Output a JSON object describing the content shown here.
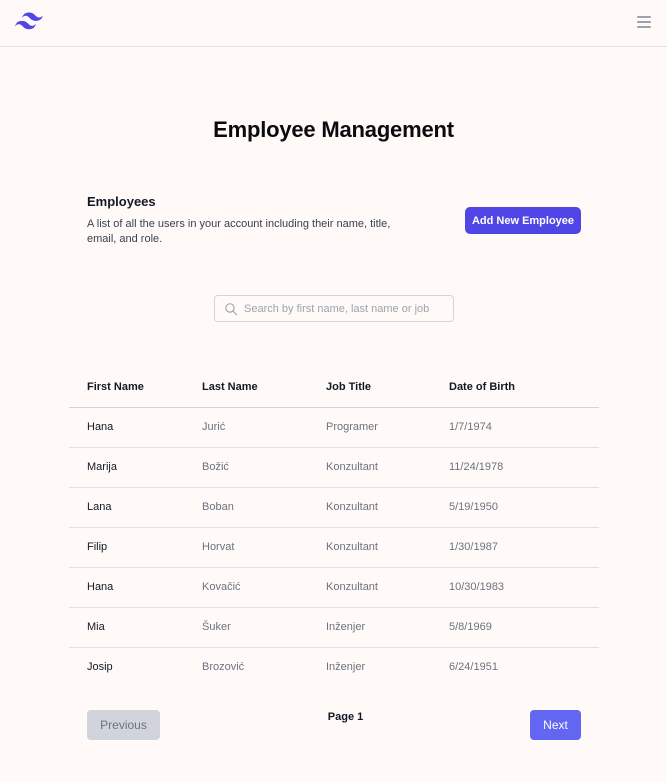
{
  "header": {
    "logo_icon": "tailwind-logo-icon",
    "menu_icon": "hamburger-menu-icon"
  },
  "page": {
    "title": "Employee Management"
  },
  "section": {
    "title": "Employees",
    "description": "A list of all the users in your account including their name, title, email, and role."
  },
  "actions": {
    "add_label": "Add New Employee"
  },
  "search": {
    "placeholder": "Search by first name, last name or job",
    "value": ""
  },
  "table": {
    "columns": [
      "First Name",
      "Last Name",
      "Job Title",
      "Date of Birth"
    ],
    "rows": [
      [
        "Hana",
        "Jurić",
        "Programer",
        "1/7/1974"
      ],
      [
        "Marija",
        "Božić",
        "Konzultant",
        "11/24/1978"
      ],
      [
        "Lana",
        "Boban",
        "Konzultant",
        "5/19/1950"
      ],
      [
        "Filip",
        "Horvat",
        "Konzultant",
        "1/30/1987"
      ],
      [
        "Hana",
        "Kovačić",
        "Konzultant",
        "10/30/1983"
      ],
      [
        "Mia",
        "Šuker",
        "Inženjer",
        "5/8/1969"
      ],
      [
        "Josip",
        "Brozović",
        "Inženjer",
        "6/24/1951"
      ]
    ]
  },
  "pagination": {
    "previous_label": "Previous",
    "page_label": "Page 1",
    "next_label": "Next"
  },
  "colors": {
    "accent": "#4f46e5",
    "next": "#6366f1",
    "background": "#fffaf7"
  }
}
